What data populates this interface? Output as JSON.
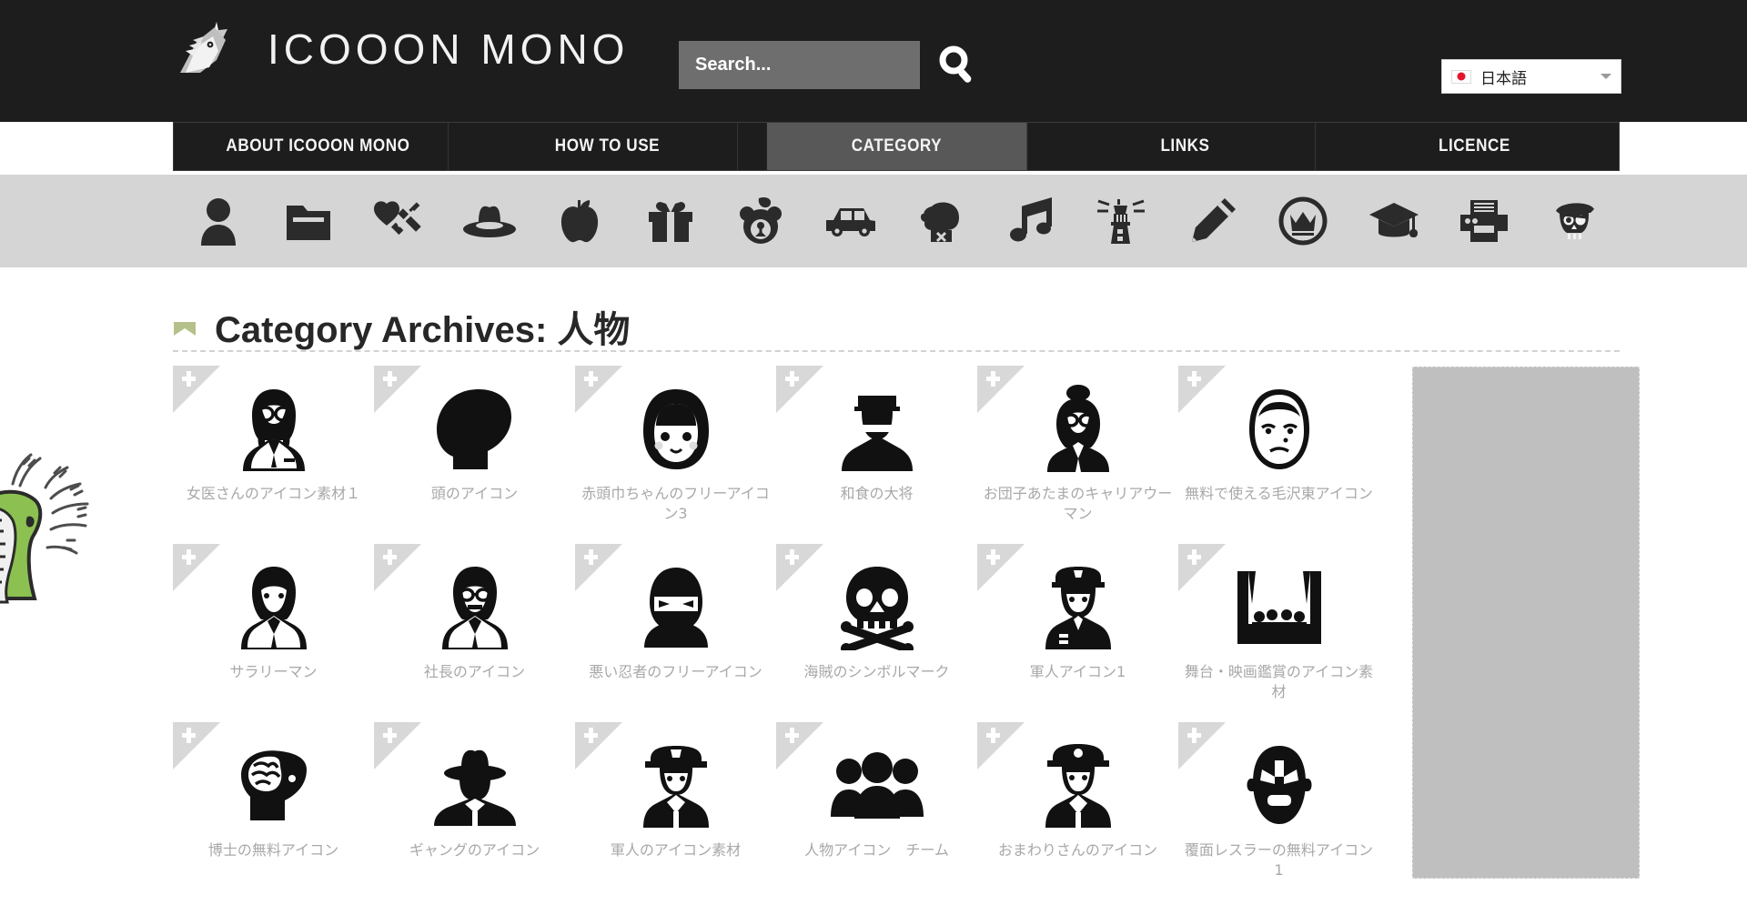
{
  "site": {
    "logo_text": "ICOOON MONO",
    "logo_icon": "unicorn-head-icon"
  },
  "search": {
    "placeholder": "Search...",
    "value": "",
    "button_icon": "magnifier-icon"
  },
  "language": {
    "selected": "日本語",
    "flag": "japan-flag-icon",
    "chevron": "chevron-down-icon"
  },
  "nav": {
    "items": [
      {
        "label": "ABOUT ICOOON MONO",
        "active": false
      },
      {
        "label": "HOW TO USE",
        "active": false
      },
      {
        "label": "CATEGORY",
        "active": true
      },
      {
        "label": "LINKS",
        "active": false
      },
      {
        "label": "LICENCE",
        "active": false
      }
    ]
  },
  "category_bar": {
    "icons": [
      "person-icon",
      "folder-icon",
      "medical-syringe-heart-icon",
      "hat-icon",
      "apple-icon",
      "gift-icon",
      "teddy-bear-icon",
      "car-icon",
      "boxing-glove-icon",
      "music-note-icon",
      "lighthouse-icon",
      "pencil-icon",
      "crown-circle-icon",
      "graduation-cap-icon",
      "printer-icon",
      "pirate-skull-icon"
    ]
  },
  "page": {
    "title_prefix": "Category Archives:",
    "title_category": "人物",
    "title": "Category Archives: 人物",
    "title_glyph": "envelope-glyph-icon"
  },
  "grid": {
    "items": [
      {
        "label": "女医さんのアイコン素材１",
        "icon": "female-doctor-icon",
        "badge": "plus-icon"
      },
      {
        "label": "頭のアイコン",
        "icon": "head-profile-icon",
        "badge": "plus-icon"
      },
      {
        "label": "赤頭巾ちゃんのフリーアイコン3",
        "icon": "red-riding-hood-icon",
        "badge": "plus-icon"
      },
      {
        "label": "和食の大将",
        "icon": "japanese-chef-icon",
        "badge": "plus-icon"
      },
      {
        "label": "お団子あたまのキャリアウーマン",
        "icon": "bun-hair-career-woman-icon",
        "badge": "plus-icon"
      },
      {
        "label": "無料で使える毛沢東アイコン",
        "icon": "mao-zedong-icon",
        "badge": "plus-icon"
      },
      {
        "label": "サラリーマン",
        "icon": "businessman-icon",
        "badge": "plus-icon"
      },
      {
        "label": "社長のアイコン",
        "icon": "company-president-icon",
        "badge": "plus-icon"
      },
      {
        "label": "悪い忍者のフリーアイコン",
        "icon": "ninja-icon",
        "badge": "plus-icon"
      },
      {
        "label": "海賊のシンボルマーク",
        "icon": "pirate-jolly-roger-icon",
        "badge": "plus-icon"
      },
      {
        "label": "軍人アイコン1",
        "icon": "soldier-icon",
        "badge": "plus-icon"
      },
      {
        "label": "舞台・映画鑑賞のアイコン素材",
        "icon": "theater-audience-icon",
        "badge": "plus-icon"
      },
      {
        "label": "博士の無料アイコン",
        "icon": "professor-brain-icon",
        "badge": "plus-icon"
      },
      {
        "label": "ギャングのアイコン",
        "icon": "gangster-icon",
        "badge": "plus-icon"
      },
      {
        "label": "軍人のアイコン素材",
        "icon": "military-officer-icon",
        "badge": "plus-icon"
      },
      {
        "label": "人物アイコン　チーム",
        "icon": "team-people-icon",
        "badge": "plus-icon"
      },
      {
        "label": "おまわりさんのアイコン",
        "icon": "policeman-icon",
        "badge": "plus-icon"
      },
      {
        "label": "覆面レスラーの無料アイコン1",
        "icon": "masked-wrestler-icon",
        "badge": "plus-icon"
      }
    ]
  },
  "sidebar": {
    "ad_placeholder": ""
  },
  "decor": {
    "frog": "frog-illustration"
  },
  "colors": {
    "header_bg": "#1d1d1d",
    "nav_active": "#585858",
    "cat_bar_bg": "#d5d5d5",
    "label_text": "#a8a8a8",
    "title_text": "#272727",
    "search_bg": "#6e6e6e",
    "ad_bg": "#bfbfbf",
    "frog_green": "#8cc152",
    "flag_red": "#e2152a"
  }
}
